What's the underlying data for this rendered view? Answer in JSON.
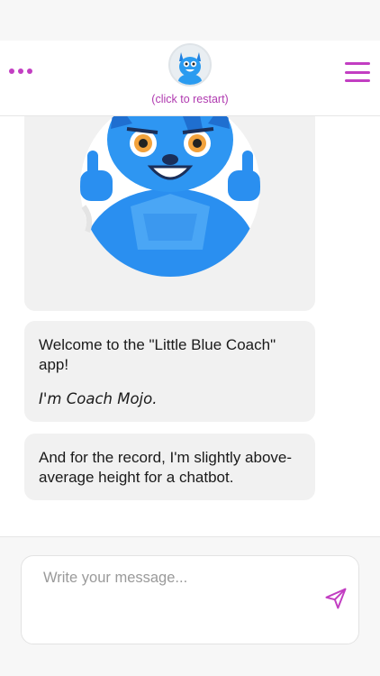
{
  "header": {
    "restart_label": "(click to restart)",
    "avatar_icon": "coach-mojo-avatar",
    "left_icon": "more-dots-icon",
    "right_icon": "hamburger-menu-icon",
    "accent_color": "#c23ec2"
  },
  "chat": {
    "messages": [
      {
        "type": "image",
        "icon": "coach-mojo-thumbs-up-image"
      },
      {
        "type": "text",
        "lines": [
          "Welcome to the \"Little Blue Coach\" app!",
          "I'm Coach Mojo."
        ]
      },
      {
        "type": "text",
        "lines": [
          "And for the record, I'm slightly above-average height for a chatbot."
        ]
      }
    ]
  },
  "composer": {
    "placeholder": "Write your message...",
    "send_icon": "send-paper-plane-icon"
  }
}
